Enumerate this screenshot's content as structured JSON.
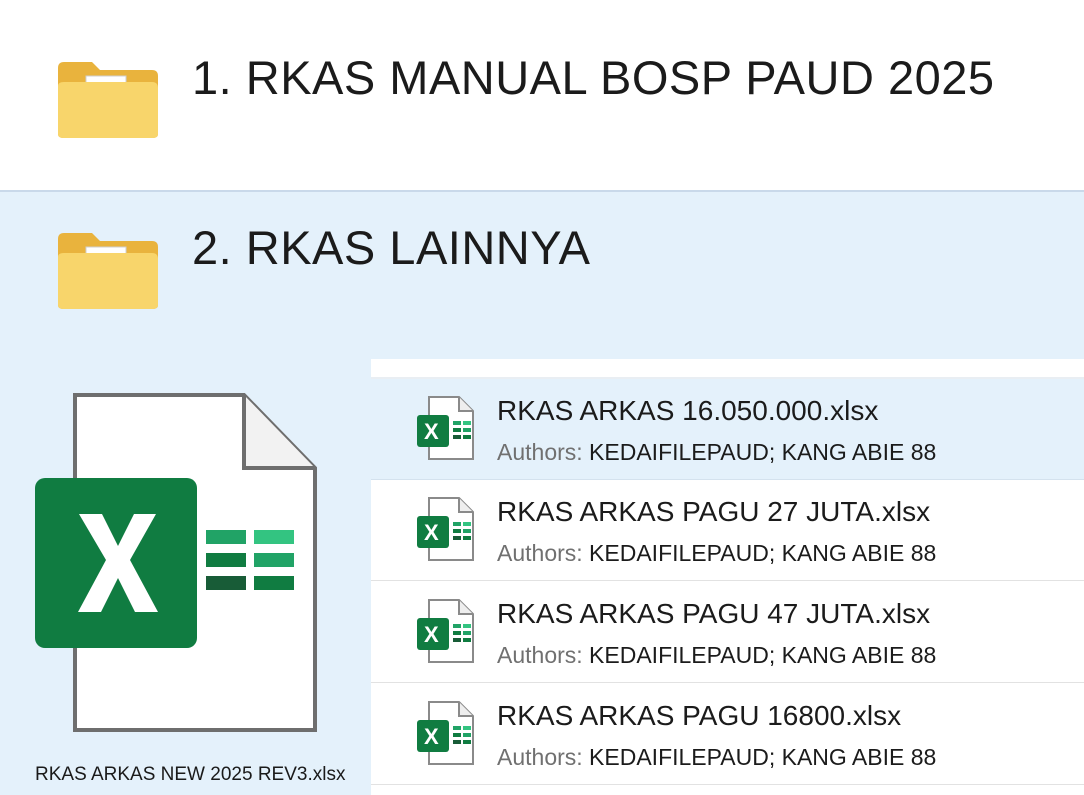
{
  "folders": [
    {
      "name": "1. RKAS MANUAL BOSP PAUD 2025",
      "icon": "folder-with-excel-icon"
    },
    {
      "name": "2. RKAS LAINNYA",
      "icon": "folder-with-excel-icon"
    }
  ],
  "thumbnail": {
    "caption": "RKAS ARKAS NEW 2025 REV3.xlsx",
    "icon": "excel-file-icon"
  },
  "files": [
    {
      "name": "RKAS ARKAS 16.050.000.xlsx",
      "authors_label": "Authors:",
      "authors": "KEDAIFILEPAUD; KANG ABIE 88",
      "selected": true
    },
    {
      "name": "RKAS ARKAS PAGU 27 JUTA.xlsx",
      "authors_label": "Authors:",
      "authors": "KEDAIFILEPAUD; KANG ABIE 88",
      "selected": false
    },
    {
      "name": "RKAS ARKAS PAGU 47 JUTA.xlsx",
      "authors_label": "Authors:",
      "authors": "KEDAIFILEPAUD; KANG ABIE 88",
      "selected": false
    },
    {
      "name": "RKAS ARKAS PAGU 16800.xlsx",
      "authors_label": "Authors:",
      "authors": "KEDAIFILEPAUD; KANG ABIE 88",
      "selected": false
    }
  ],
  "colors": {
    "excel_green": "#107c41",
    "selection_bg": "#e4f1fb",
    "folder_yellow": "#f6cc5a"
  }
}
